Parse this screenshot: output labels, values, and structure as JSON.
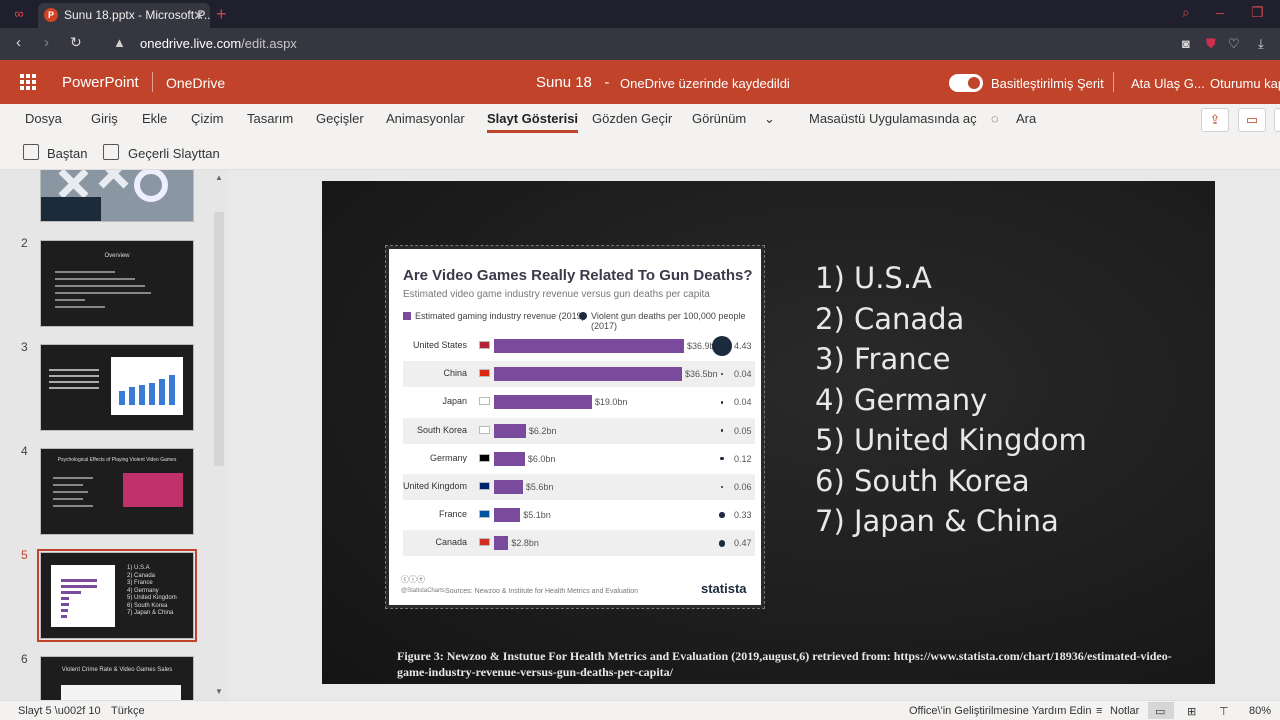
{
  "browser": {
    "tab_title": "Sunu 18.pptx - Microsoft P...",
    "url_domain": "onedrive.live.com",
    "url_path": "/edit.aspx"
  },
  "office": {
    "app": "PowerPoint",
    "service": "OneDrive",
    "doc_name": "Sunu 18",
    "doc_sep": "-",
    "save_status": "OneDrive üzerinde kaydedildi",
    "simplified_ribbon": "Basitleştirilmiş Şerit",
    "user": "Ata Ulaş G...",
    "sign_out": "Oturumu kap"
  },
  "ribbon": {
    "tabs": [
      "Dosya",
      "Giriş",
      "Ekle",
      "Çizim",
      "Tasarım",
      "Geçişler",
      "Animasyonlar",
      "Slayt Gösterisi",
      "Gözden Geçir",
      "Görünüm"
    ],
    "active_tab": "Slayt Gösterisi",
    "open_desktop": "Masaüstü Uygulamasında aç",
    "search": "Ara",
    "commands": {
      "from_start": "Baştan",
      "from_current": "Geçerli Slayttan"
    }
  },
  "thumbnails": {
    "numbers": [
      "2",
      "3",
      "4",
      "5",
      "6"
    ],
    "selected": "5",
    "titles": {
      "s2": "Overview",
      "s4": "Psychological Effects of Playing Violent Video Games",
      "s6": "Violent Crime Rate & Video Games Sales"
    }
  },
  "slide": {
    "list": [
      "1) U.S.A",
      "2) Canada",
      "3) France",
      "4) Germany",
      "5) United Kingdom",
      "6) South Korea",
      "7) Japan & China"
    ],
    "caption_prefix": "Figure 3: Newzoo & Instutue For Health Metrics and Evaluation (2019,august,6) retrieved from: ",
    "caption_url": "https://www.statista.com/chart/18936/estimated-video-game-industry-revenue-versus-gun-deaths-per-capita/"
  },
  "chart_data": {
    "type": "bar",
    "title": "Are Video Games Really Related To Gun Deaths?",
    "subtitle": "Estimated video game industry revenue versus gun deaths per capita",
    "legend": [
      "Estimated gaming industry revenue (2019)",
      "Violent gun deaths per 100,000 people (2017)"
    ],
    "categories": [
      "United States",
      "China",
      "Japan",
      "South Korea",
      "Germany",
      "United Kingdom",
      "France",
      "Canada"
    ],
    "series": [
      {
        "name": "Estimated gaming industry revenue (2019)",
        "values": [
          36.9,
          36.5,
          19.0,
          6.2,
          6.0,
          5.6,
          5.1,
          2.8
        ],
        "labels": [
          "$36.9bn",
          "$36.5bn",
          "$19.0bn",
          "$6.2bn",
          "$6.0bn",
          "$5.6bn",
          "$5.1bn",
          "$2.8bn"
        ]
      },
      {
        "name": "Violent gun deaths per 100,000 people (2017)",
        "values": [
          4.43,
          0.04,
          0.04,
          0.05,
          0.12,
          0.06,
          0.33,
          0.47
        ],
        "labels": [
          "4.43",
          "0.04",
          "0.04",
          "0.05",
          "0.12",
          "0.06",
          "0.33",
          "0.47"
        ]
      }
    ],
    "source": "Sources: Newzoo & Institute for Health Metrics and Evaluation",
    "handle": "@StatistaCharts",
    "brand": "statista"
  },
  "statusbar": {
    "slide_info": "Slayt 5 \\u002f 10",
    "language": "Türkçe",
    "help": "Office\\'in Geliştirilmesine Yardım Edin",
    "notes": "Notlar",
    "zoom": "80%"
  },
  "colors": {
    "brand": "#c0432a",
    "bar": "#7a4a9c",
    "dot": "#1c2b3d"
  }
}
